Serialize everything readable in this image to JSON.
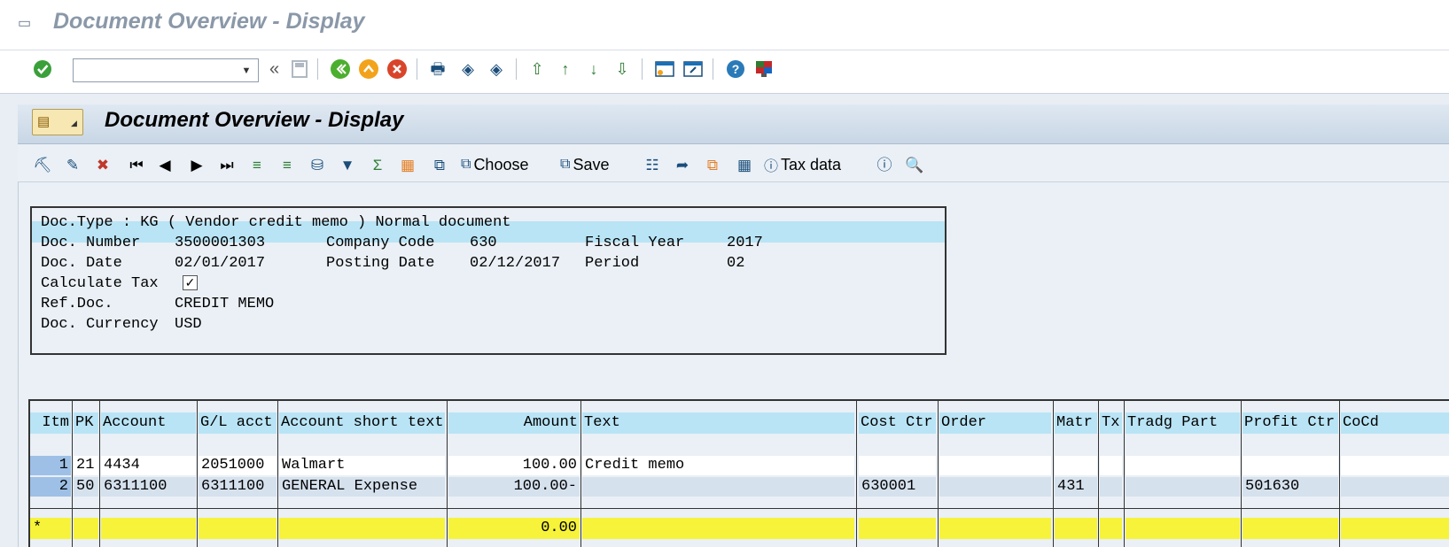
{
  "window": {
    "title": "Document Overview - Display"
  },
  "system_toolbar": {
    "command_field_value": "",
    "double_arrow": "«"
  },
  "screen": {
    "title": "Document Overview - Display"
  },
  "app_toolbar": {
    "choose_label": "Choose",
    "save_label": "Save",
    "tax_data_label": "Tax data"
  },
  "header": {
    "doc_type_line": "Doc.Type : KG ( Vendor credit memo ) Normal document",
    "doc_number_label": "Doc. Number",
    "doc_number": "3500001303",
    "company_code_label": "Company Code",
    "company_code": "630",
    "fiscal_year_label": "Fiscal Year",
    "fiscal_year": "2017",
    "doc_date_label": "Doc. Date",
    "doc_date": "02/01/2017",
    "posting_date_label": "Posting Date",
    "posting_date": "02/12/2017",
    "period_label": "Period",
    "period": "02",
    "calculate_tax_label": "Calculate Tax",
    "calculate_tax_checked": "✓",
    "ref_doc_label": "Ref.Doc.",
    "ref_doc": "CREDIT MEMO",
    "doc_currency_label": "Doc. Currency",
    "doc_currency": "USD"
  },
  "table": {
    "columns": [
      "Itm",
      "PK",
      "Account",
      "G/L acct",
      "Account short text",
      "Amount",
      "Text",
      "Cost Ctr",
      "Order",
      "Matr",
      "Tx",
      "Tradg Part",
      "Profit Ctr",
      "CoCd"
    ],
    "rows": [
      {
        "itm": "1",
        "pk": "21",
        "account": "4434",
        "gl": "2051000",
        "short_text": "Walmart",
        "amount": "100.00",
        "text": "Credit memo",
        "cost_ctr": "",
        "order": "",
        "matr": "",
        "tx": "",
        "tradg": "",
        "profit_ctr": "",
        "cocd": ""
      },
      {
        "itm": "2",
        "pk": "50",
        "account": "6311100",
        "gl": "6311100",
        "short_text": "GENERAL Expense",
        "amount": "100.00-",
        "text": "",
        "cost_ctr": "630001",
        "order": "",
        "matr": "431",
        "tx": "",
        "tradg": "",
        "profit_ctr": "501630",
        "cocd": ""
      }
    ],
    "sum_marker": "*",
    "sum_amount": "0.00"
  },
  "colors": {
    "header_cell": "#b9e4f5",
    "sum_row": "#f6f33a",
    "selected_row": "#d6e1ee"
  }
}
